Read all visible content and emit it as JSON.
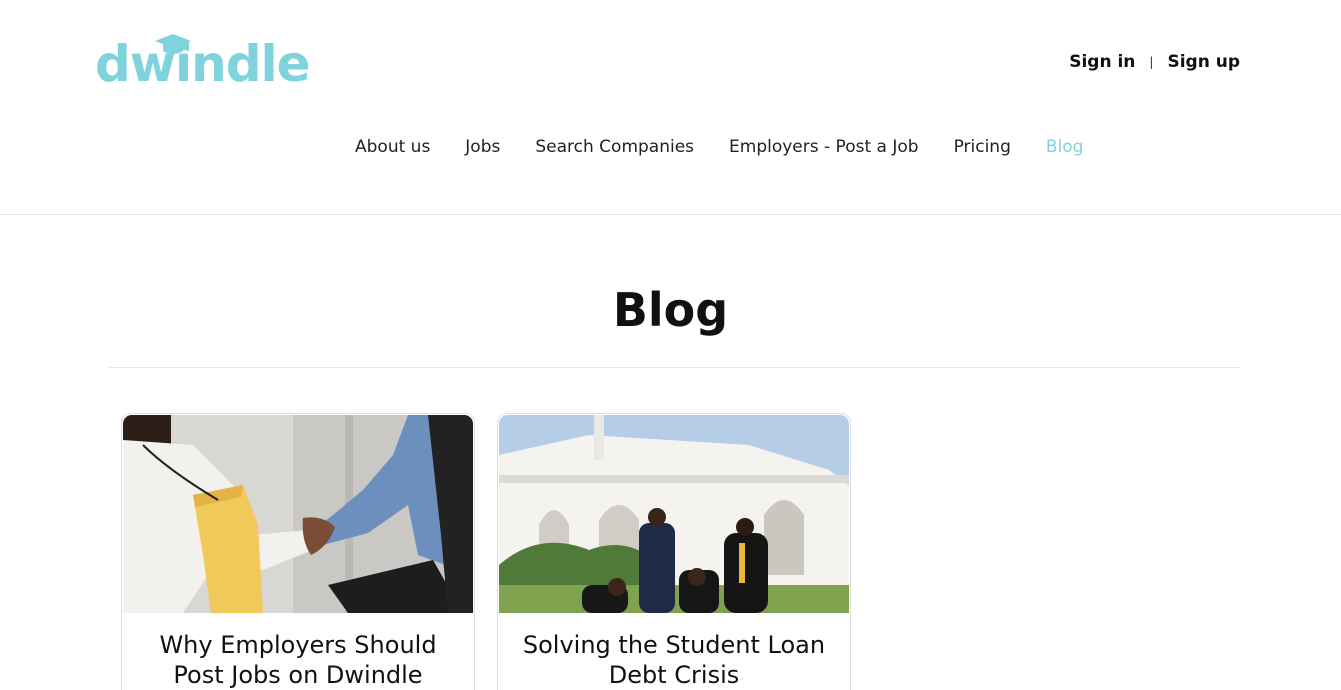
{
  "brand": {
    "name": "dwindle",
    "accent_color": "#7fd3dc",
    "logo_icon": "graduation-cap-icon"
  },
  "auth": {
    "sign_in": "Sign in",
    "separator": "|",
    "sign_up": "Sign up"
  },
  "nav": {
    "items": [
      {
        "label": "About us",
        "active": false
      },
      {
        "label": "Jobs",
        "active": false
      },
      {
        "label": "Search Companies",
        "active": false
      },
      {
        "label": "Employers - Post a Job",
        "active": false
      },
      {
        "label": "Pricing",
        "active": false
      },
      {
        "label": "Blog",
        "active": true
      }
    ]
  },
  "page": {
    "title": "Blog"
  },
  "posts": [
    {
      "title": "Why Employers Should Post Jobs on Dwindle",
      "image": "handshake-photo"
    },
    {
      "title": "Solving the Student Loan Debt Crisis",
      "image": "graduates-photo"
    }
  ]
}
